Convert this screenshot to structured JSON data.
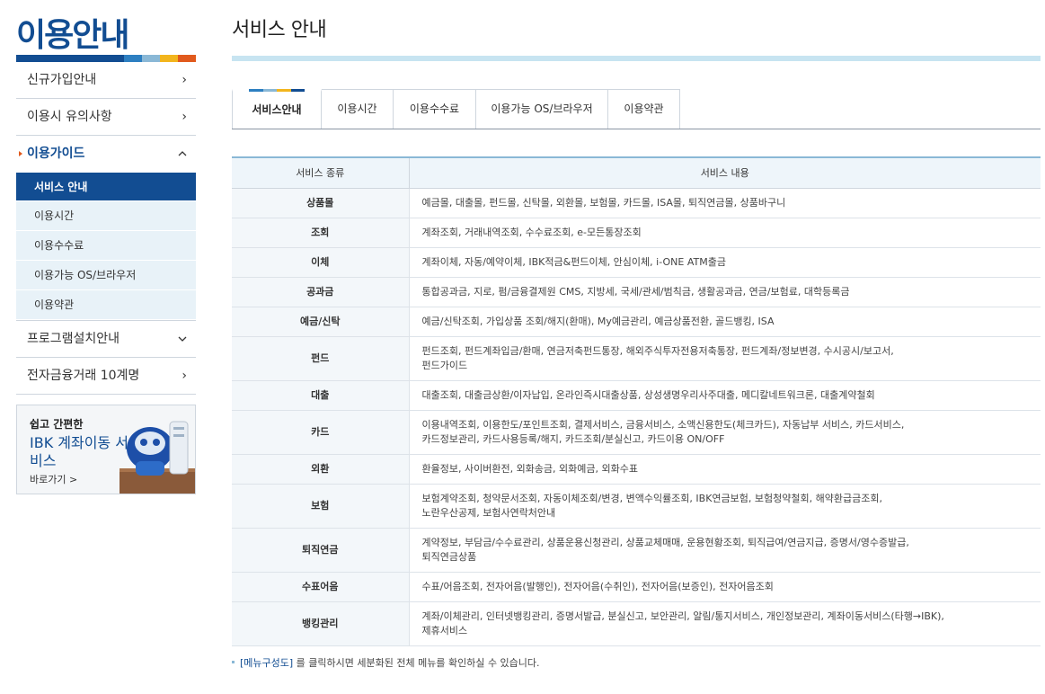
{
  "sidebar": {
    "title": "이용안내",
    "title_bar_colors": [
      "#124d92",
      "#2d7fc1",
      "#e15a1d",
      "#f2b51d"
    ],
    "nav": [
      {
        "label": "신규가입안내",
        "chevron": "›"
      },
      {
        "label": "이용시 유의사항",
        "chevron": "›"
      },
      {
        "label": "이용가이드",
        "chevron": "ˆ"
      },
      {
        "label": "프로그램설치안내",
        "chevron": "ˇ"
      },
      {
        "label": "전자금융거래 10계명",
        "chevron": "›"
      }
    ],
    "subnav": [
      "서비스 안내",
      "이용시간",
      "이용수수료",
      "이용가능 OS/브라우저",
      "이용약관"
    ],
    "banner": {
      "line1": "쉽고 간편한",
      "line2": "IBK 계좌이동 서비스",
      "more": "바로가기 >"
    }
  },
  "main": {
    "title": "서비스 안내",
    "tabs": [
      "서비스안내",
      "이용시간",
      "이용수수료",
      "이용가능 OS/브라우저",
      "이용약관"
    ],
    "tab_stripe_colors": [
      "#2d7fc1",
      "#124d92",
      "#f2b51d",
      "#8ab8d6"
    ],
    "table": {
      "headers": [
        "서비스 종류",
        "서비스 내용"
      ],
      "rows": [
        {
          "category": "상품몰",
          "content": "예금몰, 대출몰, 펀드몰, 신탁몰, 외환몰, 보험몰, 카드몰, ISA몰, 퇴직연금몰, 상품바구니"
        },
        {
          "category": "조회",
          "content": "계좌조회, 거래내역조회, 수수료조회, e-모든통장조회"
        },
        {
          "category": "이체",
          "content": "계좌이체, 자동/예약이체, IBK적금&펀드이체, 안심이체, i-ONE ATM출금"
        },
        {
          "category": "공과금",
          "content": "통합공과금, 지로, 펌/금융결제원 CMS, 지방세, 국세/관세/범칙금, 생활공과금, 연금/보험료, 대학등록금"
        },
        {
          "category": "예금/신탁",
          "content": "예금/신탁조회, 가입상품 조회/해지(환매), My예금관리, 예금상품전환, 골드뱅킹, ISA"
        },
        {
          "category": "펀드",
          "content": "펀드조회, 펀드계좌입금/환매, 연금저축펀드통장, 해외주식투자전용저축통장, 펀드계좌/정보변경, 수시공시/보고서,",
          "content2": "펀드가이드"
        },
        {
          "category": "대출",
          "content": "대출조회, 대출금상환/이자납입, 온라인즉시대출상품, 상성생명우리사주대출, 메디칼네트워크론, 대출계약철회"
        },
        {
          "category": "카드",
          "content": "이용내역조회, 이용한도/포인트조회, 결제서비스, 금융서비스, 소액신용한도(체크카드), 자동납부 서비스, 카드서비스,",
          "content2": "카드정보관리, 카드사용등록/해지, 카드조회/분실신고, 카드이용 ON/OFF"
        },
        {
          "category": "외환",
          "content": "환율정보, 사이버환전, 외화송금, 외화예금, 외화수표"
        },
        {
          "category": "보험",
          "content": "보험계약조회, 청약문서조회, 자동이체조회/변경, 변액수익률조회, IBK연금보험, 보험청약철회, 해약환급금조회,",
          "content2": "노란우산공제, 보험사연락처안내"
        },
        {
          "category": "퇴직연금",
          "content": "계약정보, 부담금/수수료관리, 상품운용신청관리, 상품교체매매, 운용현황조회, 퇴직급여/연금지급, 증명서/영수증발급,",
          "content2": "퇴직연금상품"
        },
        {
          "category": "수표어음",
          "content": "수표/어음조회, 전자어음(발행인), 전자어음(수취인), 전자어음(보증인), 전자어음조회"
        },
        {
          "category": "뱅킹관리",
          "content": "계좌/이체관리, 인터넷뱅킹관리, 증명서발급, 분실신고, 보안관리, 알림/통지서비스, 개인정보관리, 계좌이동서비스(타행→IBK),",
          "content2": "제휴서비스"
        }
      ]
    },
    "note": {
      "link": "[메뉴구성도]",
      "text": " 를 클릭하시면 세분화된 전체 메뉴를 확인하실 수 있습니다."
    }
  },
  "colors": {
    "brand": "#124d92",
    "accent": "#e15a1d",
    "light_blue": "#c7e4f1"
  },
  "icons": [
    "chevron-right-icon",
    "chevron-up-icon",
    "chevron-down-icon",
    "robot-mascot"
  ]
}
